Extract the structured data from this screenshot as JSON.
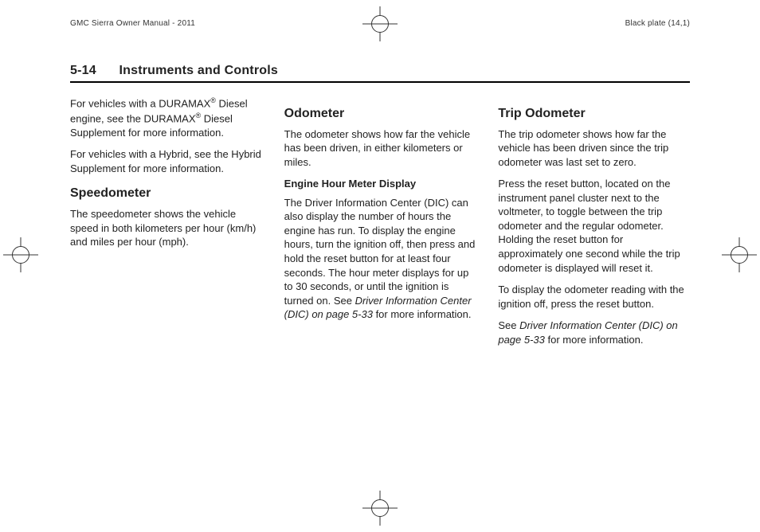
{
  "top": {
    "left": "GMC Sierra Owner Manual - 2011",
    "right": "Black plate (14,1)"
  },
  "header": {
    "secno": "5-14",
    "title": "Instruments and Controls"
  },
  "col1": {
    "p1_a": "For vehicles with a DURAMAX",
    "p1_b": " Diesel engine, see the DURAMAX",
    "p1_c": " Diesel Supplement for more information.",
    "reg": "®",
    "p2": "For vehicles with a Hybrid, see the Hybrid Supplement for more information.",
    "h_speed": "Speedometer",
    "p3": "The speedometer shows the vehicle speed in both kilometers per hour (km/h) and miles per hour (mph)."
  },
  "col2": {
    "h_odo": "Odometer",
    "p1": "The odometer shows how far the vehicle has been driven, in either kilometers or miles.",
    "h_engine": "Engine Hour Meter Display",
    "p2_a": "The Driver Information Center (DIC) can also display the number of hours the engine has run. To display the engine hours, turn the ignition off, then press and hold the reset button for at least four seconds. The hour meter displays for up to 30 seconds, or until the ignition is turned on. See ",
    "p2_ital": "Driver Information Center (DIC) on page 5‑33",
    "p2_b": " for more information."
  },
  "col3": {
    "h_trip": "Trip Odometer",
    "p1": "The trip odometer shows how far the vehicle has been driven since the trip odometer was last set to zero.",
    "p2": "Press the reset button, located on the instrument panel cluster next to the voltmeter, to toggle between the trip odometer and the regular odometer. Holding the reset button for approximately one second while the trip odometer is displayed will reset it.",
    "p3": "To display the odometer reading with the ignition off, press the reset button.",
    "p4_a": "See ",
    "p4_ital": "Driver Information Center (DIC) on page 5‑33",
    "p4_b": " for more information."
  }
}
